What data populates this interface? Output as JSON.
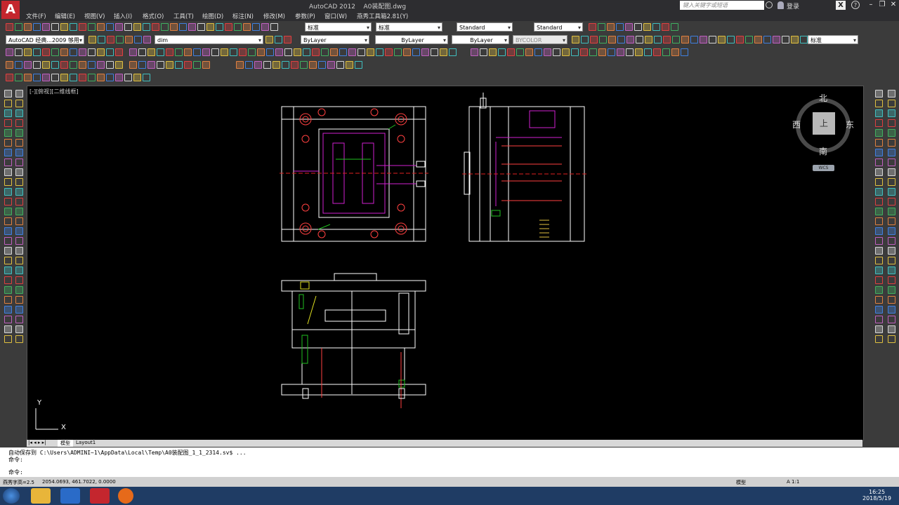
{
  "window": {
    "app_title": "AutoCAD 2012",
    "file_name": "A0装配图.dwg",
    "search_placeholder": "键入关键字或短语",
    "login_label": "登录",
    "logo_letter": "A"
  },
  "menu": [
    "文件(F)",
    "编辑(E)",
    "视图(V)",
    "插入(I)",
    "格式(O)",
    "工具(T)",
    "绘图(D)",
    "标注(N)",
    "修改(M)",
    "参数(P)",
    "窗口(W)",
    "燕秀工具箱2.81(Y)"
  ],
  "toolbar": {
    "workspace": "AutoCAD 经典...2009 够用",
    "layer": "dim",
    "text_style": "标准",
    "dim_style": "标准",
    "table_style": "Standard",
    "multileader_style": "Standard",
    "color": "ByLayer",
    "linetype": "ByLayer",
    "lineweight": "ByLayer",
    "plotstyle": "BYCOLOR",
    "annotation_scale": "标准"
  },
  "viewport": {
    "label": "[-][俯视][二维线框]"
  },
  "viewcube": {
    "north": "北",
    "south": "南",
    "east": "东",
    "west": "西",
    "top": "上",
    "wcs": "WCS"
  },
  "ucs": {
    "x": "X",
    "y": "Y"
  },
  "tabs": [
    "模型",
    "Layout1"
  ],
  "command": {
    "history": "自动保存到 C:\\Users\\ADMINI~1\\AppData\\Local\\Temp\\A0装配图_1_1_2314.sv$ ...",
    "prompt1": "命令:",
    "prompt2": "命令:"
  },
  "status": {
    "left_text": "燕秀字高=2.5",
    "coords": "2054.0693, 461.7022, 0.0000",
    "model": "模型",
    "scale": "A 1:1"
  },
  "clock": {
    "time": "16:25",
    "date": "2018/5/19"
  },
  "colors": {
    "canvas": "#000000",
    "chrome": "#3b3b3b",
    "drawing_line": "#ffffff",
    "magenta": "#d020d0",
    "green": "#20c020",
    "red": "#e02020",
    "yellow": "#e0e020"
  }
}
